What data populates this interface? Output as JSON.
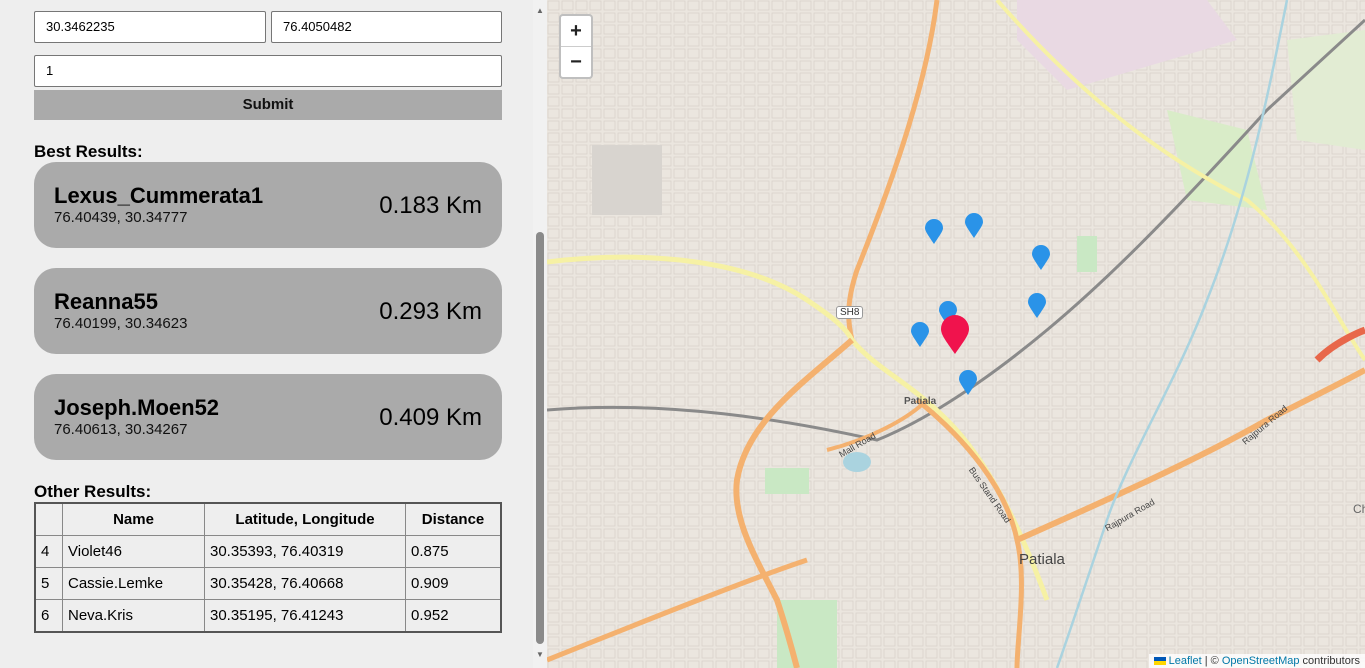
{
  "form": {
    "latitude": "30.3462235",
    "longitude": "76.4050482",
    "count": "1",
    "submit_label": "Submit"
  },
  "best": {
    "heading": "Best Results:",
    "cards": [
      {
        "name": "Lexus_Cummerata1",
        "coords": "76.40439, 30.34777",
        "distance": "0.183 Km"
      },
      {
        "name": "Reanna55",
        "coords": "76.40199, 30.34623",
        "distance": "0.293 Km"
      },
      {
        "name": "Joseph.Moen52",
        "coords": "76.40613, 30.34267",
        "distance": "0.409 Km"
      }
    ]
  },
  "other": {
    "heading": "Other Results:",
    "columns": [
      "",
      "Name",
      "Latitude, Longitude",
      "Distance"
    ],
    "rows": [
      {
        "rank": "4",
        "name": "Violet46",
        "coords": "30.35393, 76.40319",
        "distance": "0.875"
      },
      {
        "rank": "5",
        "name": "Cassie.Lemke",
        "coords": "30.35428, 76.40668",
        "distance": "0.909"
      },
      {
        "rank": "6",
        "name": "Neva.Kris",
        "coords": "30.35195, 76.41243",
        "distance": "0.952"
      }
    ]
  },
  "map": {
    "zoom_in": "+",
    "zoom_out": "−",
    "labels": {
      "city": "Patiala",
      "station": "Patiala",
      "sh8": "SH8",
      "mall_road": "Mall Road",
      "bus_stand_road": "Bus Stand Road",
      "rajpura_road": "Rajpura Road",
      "rajpura_road2": "Rajpura Road",
      "cha": "Cha"
    },
    "attribution": {
      "leaflet": "Leaflet",
      "sep": " | © ",
      "osm": "OpenStreetMap",
      "contrib": " contributors"
    },
    "colors": {
      "marker": "#2a93e8",
      "selected_marker": "#f0134d"
    }
  }
}
